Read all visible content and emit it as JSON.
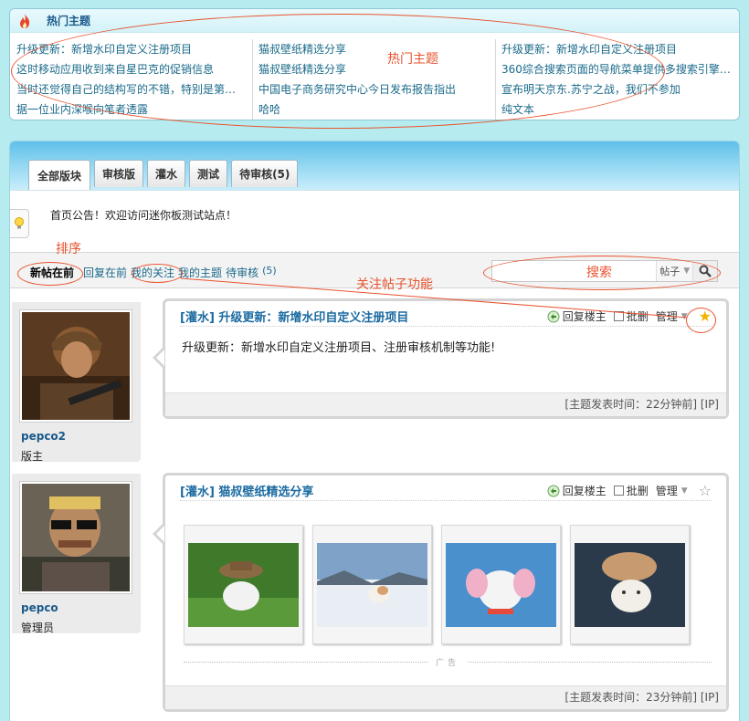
{
  "hot": {
    "title": "热门主题",
    "col1": [
      "升级更新：新增水印自定义注册项目",
      "这时移动应用收到来自星巴克的促销信息",
      "当时还觉得自己的结构写的不错，特别是第…",
      "据一位业内深喉向笔者透露"
    ],
    "col2": [
      "猫叔壁纸精选分享",
      "猫叔壁纸精选分享",
      "中国电子商务研究中心今日发布报告指出",
      "哈哈"
    ],
    "col3": [
      "升级更新：新增水印自定义注册项目",
      "360综合搜索页面的导航菜单提供多搜索引擎…",
      "宣布明天京东.苏宁之战，我们不参加",
      "纯文本"
    ]
  },
  "tabs": [
    "全部版块",
    "审核版",
    "灌水",
    "测试",
    "待审核(5)"
  ],
  "notice": "首页公告！欢迎访问迷你板测试站点！",
  "sort": {
    "newest": "新帖在前",
    "reply_first": "回复在前",
    "my_follow": "我的关注",
    "my_topics": "我的主题",
    "pending": "待审核",
    "pending_count": "(5)"
  },
  "search": {
    "placeholder": "",
    "type": "帖子"
  },
  "annotations": {
    "hot": "热门主题",
    "sort": "排序",
    "search": "搜索",
    "follow": "关注帖子功能"
  },
  "posts": [
    {
      "username": "pepco2",
      "role": "版主",
      "title": "[灌水] 升级更新：新增水印自定义注册项目",
      "body": "升级更新：新增水印自定义注册项目、注册审核机制等功能!",
      "reply": "回复楼主",
      "batch_delete": "批删",
      "manage": "管理",
      "footer": "[主题发表时间：22分钟前] [IP]",
      "starred": true
    },
    {
      "username": "pepco",
      "role": "管理员",
      "title": "[灌水] 猫叔壁纸精选分享",
      "reply": "回复楼主",
      "batch_delete": "批删",
      "manage": "管理",
      "ad_label": "广告",
      "footer": "[主题发表时间：23分钟前] [IP]",
      "starred": false
    }
  ],
  "colors": {
    "background": "#b6ecef",
    "link": "#1a6a8a",
    "annotation": "#e8532e",
    "star_active": "#f0b400"
  }
}
